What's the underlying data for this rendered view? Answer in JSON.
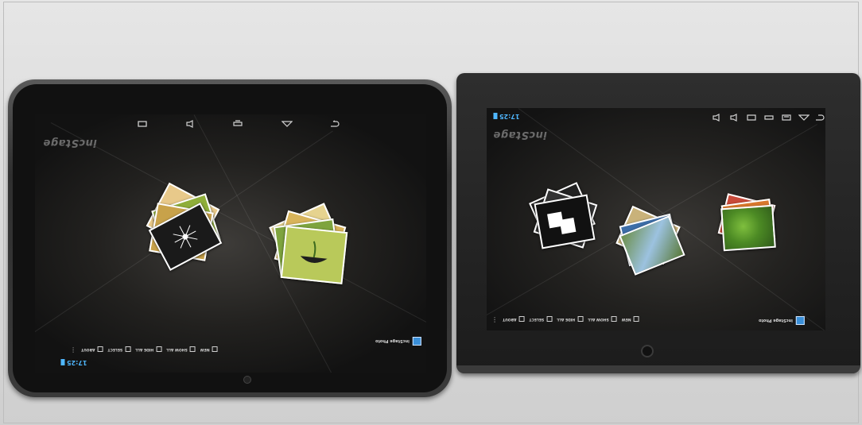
{
  "scene": {
    "left_tablet": {
      "watermark": "incStage",
      "app_name": "incStage Photo",
      "status_time": "17:25",
      "toolbar": [
        "NEW",
        "SHOW ALL",
        "HIDE ALL",
        "SELECT",
        "ABOUT"
      ],
      "menu_glyph": "⋮",
      "stacks": [
        {
          "name": "dandelion-album",
          "colors": [
            "#f4f4f4",
            "#c8a24a",
            "#8fae3a",
            "#d9d9d9",
            "#e8c98a"
          ]
        },
        {
          "name": "sprout-album",
          "colors": [
            "#f0f0f0",
            "#b9c95a",
            "#d8b45a",
            "#7ea43e",
            "#e6d38f"
          ]
        }
      ]
    },
    "right_tablet": {
      "watermark": "incStage",
      "app_name": "incStage Photo",
      "status_time": "17:25",
      "toolbar": [
        "NEW",
        "SHOW ALL",
        "HIDE ALL",
        "SELECT",
        "ABOUT"
      ],
      "menu_glyph": "⋮",
      "stacks": [
        {
          "name": "monochrome-album",
          "colors": [
            "#ffffff",
            "#222222",
            "#ffffff",
            "#333333"
          ]
        },
        {
          "name": "waterfall-album",
          "colors": [
            "#e7e7e7",
            "#6c8f4a",
            "#3d6ea8",
            "#c9b27a"
          ]
        },
        {
          "name": "tree-album",
          "colors": [
            "#f2f2f2",
            "#5e9a33",
            "#d9782d",
            "#c94a3a"
          ]
        }
      ]
    },
    "accent_status_color": "#4fb7ff"
  }
}
